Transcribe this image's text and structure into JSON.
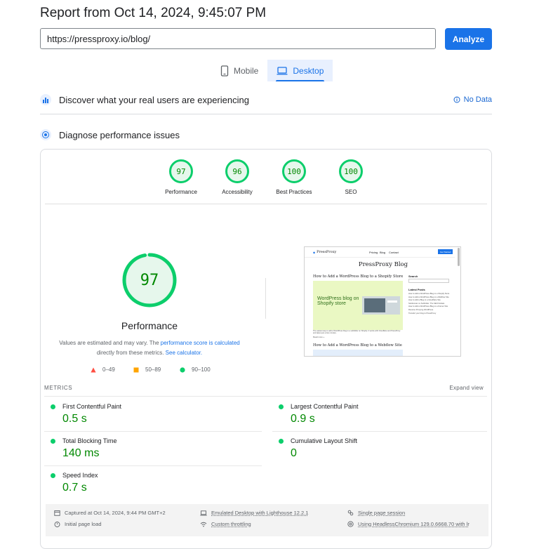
{
  "report": {
    "title": "Report from Oct 14, 2024, 9:45:07 PM"
  },
  "url_bar": {
    "value": "https://pressproxy.io/blog/",
    "analyze_label": "Analyze"
  },
  "tabs": [
    {
      "label": "Mobile",
      "icon": "phone-icon",
      "active": false
    },
    {
      "label": "Desktop",
      "icon": "laptop-icon",
      "active": true
    }
  ],
  "field_data": {
    "heading": "Discover what your real users are experiencing",
    "status": "No Data"
  },
  "diagnose": {
    "heading": "Diagnose performance issues"
  },
  "categories": [
    {
      "score": "97",
      "label": "Performance"
    },
    {
      "score": "96",
      "label": "Accessibility"
    },
    {
      "score": "100",
      "label": "Best Practices"
    },
    {
      "score": "100",
      "label": "SEO"
    }
  ],
  "performance": {
    "score": 97,
    "score_text": "97",
    "label": "Performance",
    "note_prefix": "Values are estimated and may vary. The ",
    "note_link": "performance score is calculated",
    "note_mid": " directly from these metrics. ",
    "note_link2": "See calculator.",
    "legend": [
      {
        "label": "0–49",
        "color": "#ff4e42"
      },
      {
        "label": "50–89",
        "color": "#ffa400"
      },
      {
        "label": "90–100",
        "color": "#0cce6b"
      }
    ]
  },
  "screenshot": {
    "site_name": "PressProxy",
    "nav": [
      "Pricing",
      "Blog",
      "Contact"
    ],
    "nav_button": "Get Started",
    "blog_title": "PressProxy Blog",
    "post1_title": "How to Add a WordPress Blog to a Shopify Store",
    "post1_image_text": "WordPress blog on Shopify store",
    "post1_excerpt": "The easiest way to add a WordPress blog to a subfolder on Shopify. It works with Cloudflare and PressProxy and takes just a few minutes.",
    "read_more": "Read more »",
    "post2_title": "How to Add a WordPress Blog to a Webflow Site",
    "sidebar_search": "Search",
    "sidebar_latest": "Latest Posts",
    "latest_posts": [
      "How to Add a WordPress Blog to a Shopify Store",
      "How to Add a WordPress Blog to a Webflow Site",
      "How to Add a Blog to a Cloudflare Site",
      "Subdomain vs Subfolder: The SEO Debate",
      "How to Add a WordPress Blog to a Framer Site",
      "Reverse Proxying WordPress",
      "Transfer your blog to PressProxy"
    ]
  },
  "metrics": {
    "header": "METRICS",
    "expand": "Expand view",
    "items": [
      {
        "label": "First Contentful Paint",
        "value": "0.5 s"
      },
      {
        "label": "Largest Contentful Paint",
        "value": "0.9 s"
      },
      {
        "label": "Total Blocking Time",
        "value": "140 ms"
      },
      {
        "label": "Cumulative Layout Shift",
        "value": "0"
      },
      {
        "label": "Speed Index",
        "value": "0.7 s"
      }
    ]
  },
  "footer": {
    "captured": "Captured at Oct 14, 2024, 9:44 PM GMT+2",
    "load": "Initial page load",
    "device": "Emulated Desktop with Lighthouse 12.2.1",
    "throttling": "Custom throttling",
    "session": "Single page session",
    "browser": "Using HeadlessChromium 129.0.6668.70 with lr"
  },
  "colors": {
    "accent": "#1a73e8",
    "pass": "#0cce6b",
    "pass_text": "#008800",
    "average": "#ffa400",
    "fail": "#ff4e42"
  }
}
